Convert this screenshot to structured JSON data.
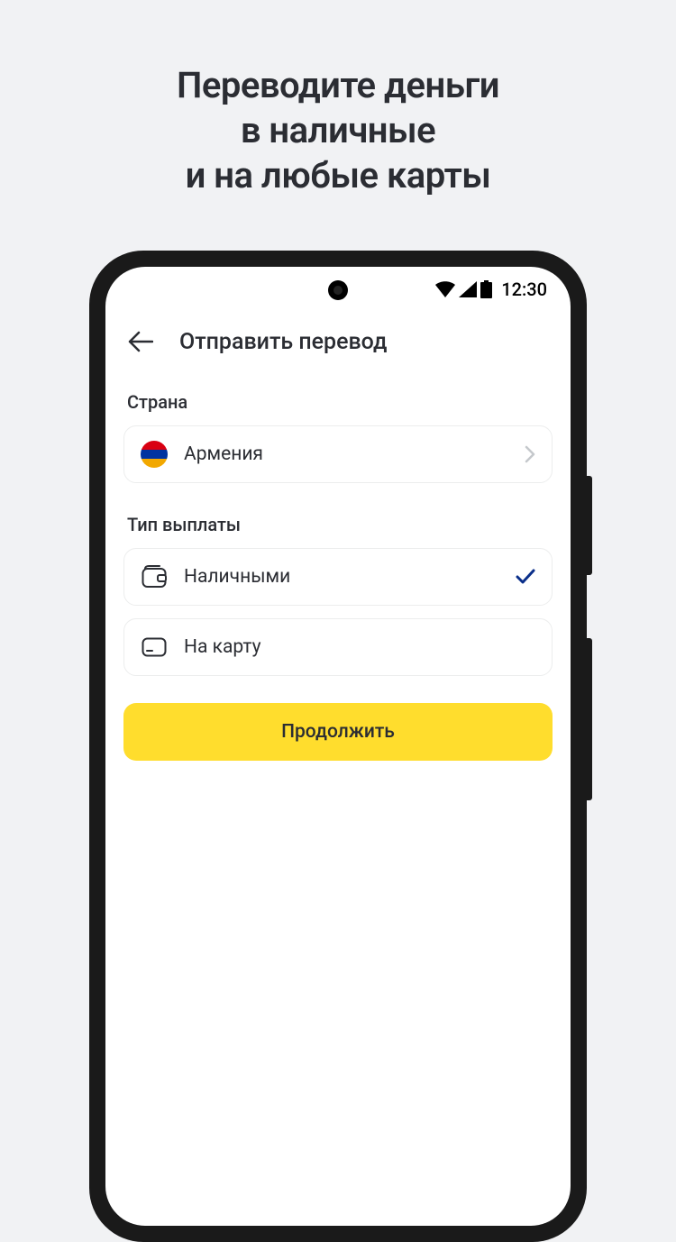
{
  "promo": {
    "line1": "Переводите деньги",
    "line2": "в наличные",
    "line3": "и на любые карты"
  },
  "statusbar": {
    "time": "12:30"
  },
  "header": {
    "title": "Отправить перевод"
  },
  "country": {
    "label": "Страна",
    "selected": "Армения"
  },
  "payout": {
    "label": "Тип выплаты",
    "options": [
      {
        "label": "Наличными",
        "selected": true
      },
      {
        "label": "На карту",
        "selected": false
      }
    ]
  },
  "cta": {
    "label": "Продолжить"
  },
  "colors": {
    "accent": "#ffdd2d",
    "check": "#0a2f8a"
  }
}
